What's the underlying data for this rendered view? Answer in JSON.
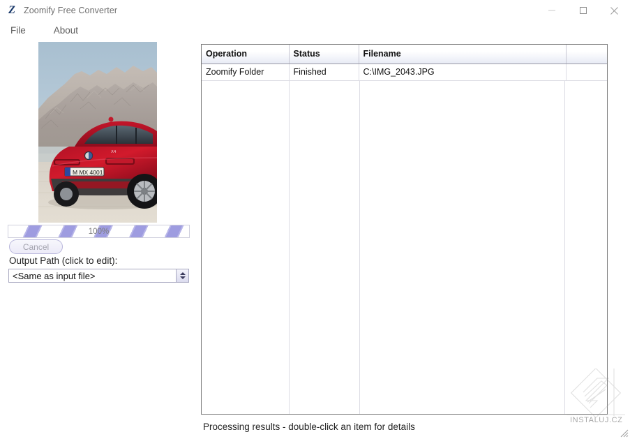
{
  "window": {
    "title": "Zoomify Free Converter",
    "logo_icon": "zoomify-z-logo",
    "minimize_label": "Minimize",
    "maximize_label": "Maximize",
    "close_label": "Close"
  },
  "menu": {
    "items": [
      {
        "label": "File"
      },
      {
        "label": "About"
      }
    ]
  },
  "left_panel": {
    "preview_alt": "Red BMW X4 SUV parked in front of a mountain range",
    "progress": {
      "percent_label": "100%",
      "value": 100
    },
    "cancel_label": "Cancel",
    "output_path_label": "Output Path (click to edit):",
    "output_path_value": "<Same as input file>"
  },
  "results": {
    "columns": [
      "Operation",
      "Status",
      "Filename",
      ""
    ],
    "rows": [
      {
        "operation": "Zoomify Folder",
        "status": "Finished",
        "filename": "C:\\IMG_2043.JPG",
        "extra": ""
      }
    ],
    "status_text": "Processing results - double-click an item for details",
    "status_color": "#2f8a2f"
  },
  "watermark": {
    "text": "INSTALUJ.CZ"
  }
}
